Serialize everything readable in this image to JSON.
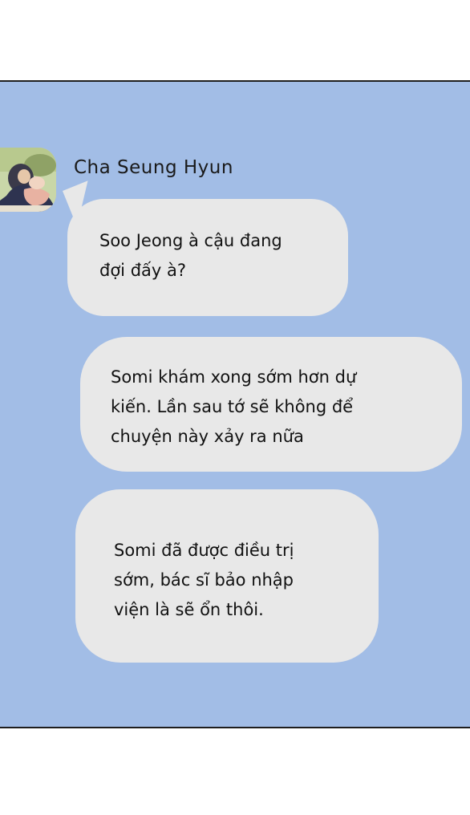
{
  "chat": {
    "sender": "Cha Seung Hyun",
    "messages": [
      {
        "lines": [
          "Soo Jeong à cậu đang",
          "đợi đấy à?"
        ]
      },
      {
        "lines": [
          "Somi khám xong sớm hơn dự",
          "kiến. Lần sau tớ sẽ không để",
          "chuyện này xảy ra nữa"
        ]
      },
      {
        "lines": [
          "Somi đã được điều trị",
          "sớm, bác sĩ bảo nhập",
          "viện là sẽ ổn thôi."
        ]
      }
    ]
  },
  "colors": {
    "panel_background": "#a2bde6",
    "bubble_background": "#e8e8e8",
    "border": "#1e1e1e"
  }
}
